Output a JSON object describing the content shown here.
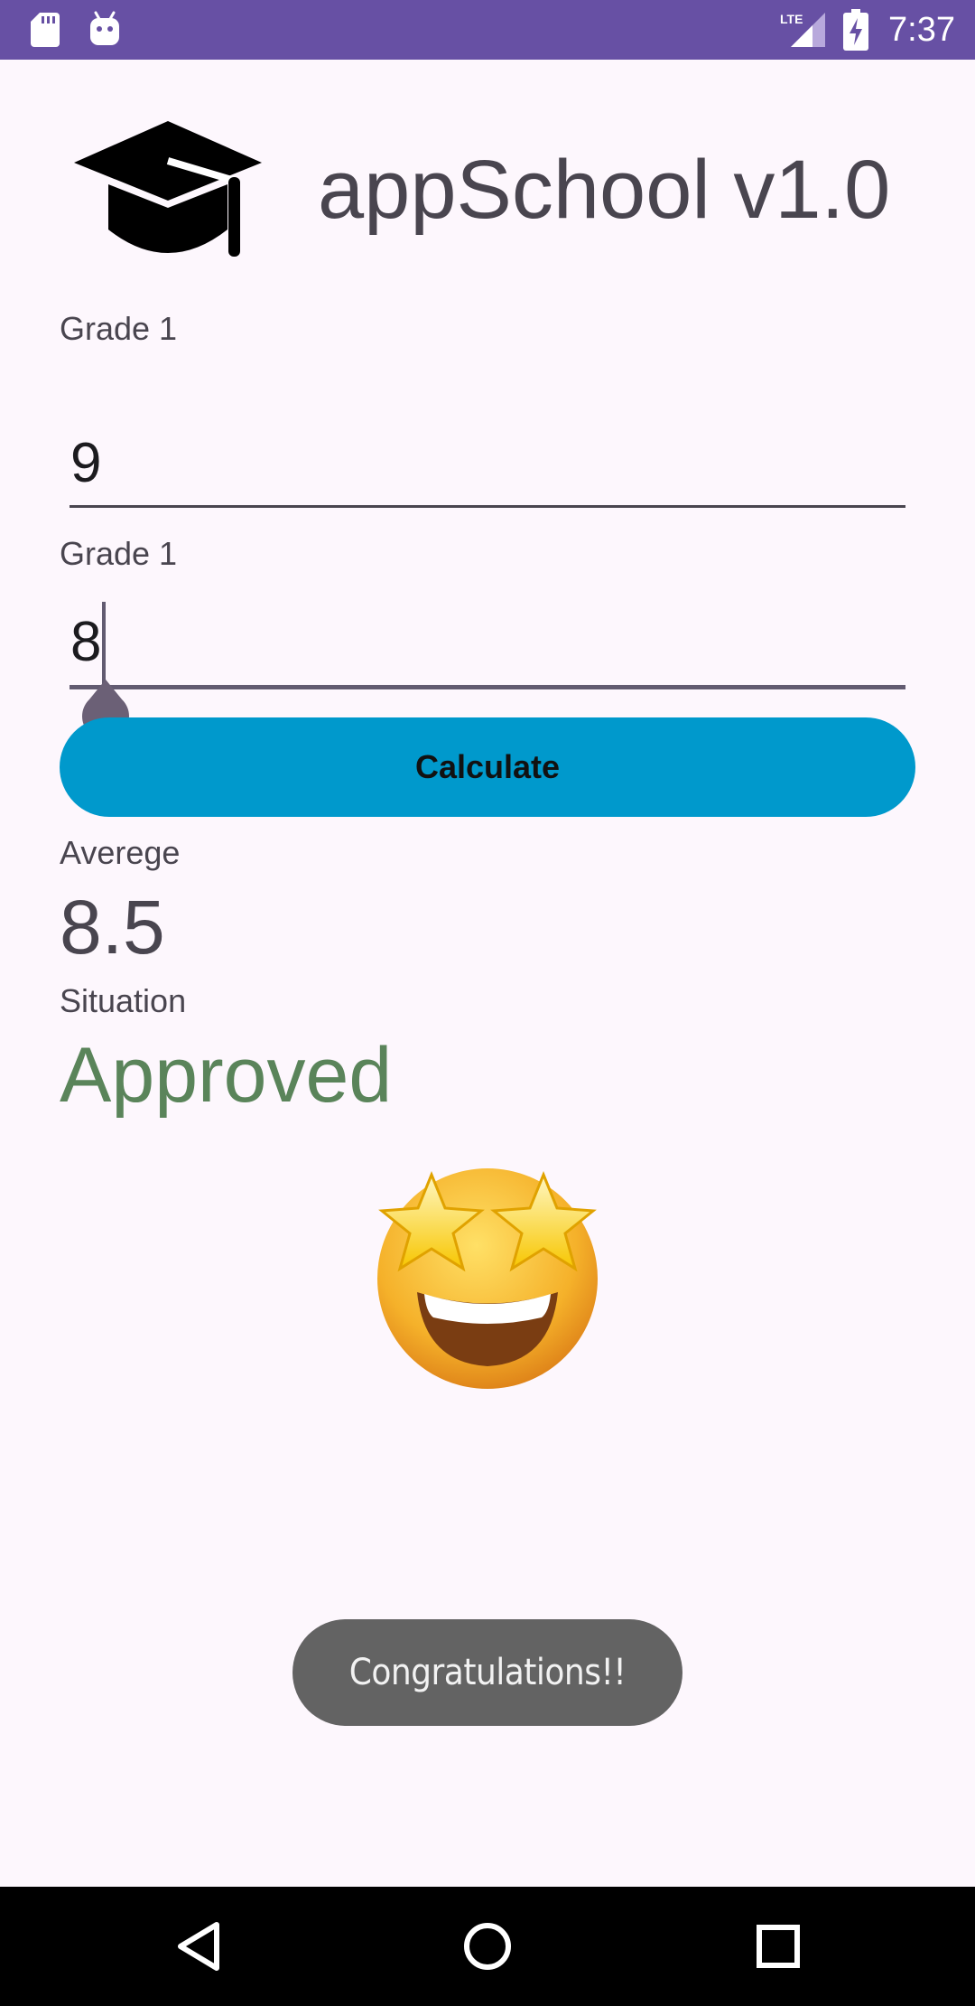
{
  "status_bar": {
    "time": "7:37",
    "network": "LTE",
    "icons": [
      "sd-card-icon",
      "android-debug-icon",
      "lte-signal-icon",
      "battery-charging-icon"
    ],
    "color": "#6750a4"
  },
  "header": {
    "logo_icon": "graduation-cap-icon",
    "title": "appSchool v1.0"
  },
  "form": {
    "grade1_label": "Grade 1",
    "grade1_value": "9",
    "grade2_label": "Grade 1",
    "grade2_value": "8",
    "calculate_label": "Calculate",
    "button_color": "#0099cc"
  },
  "result": {
    "average_label": "Averege",
    "average_value": "8.5",
    "situation_label": "Situation",
    "situation_value": "Approved",
    "situation_color": "#5a845a",
    "emoji_icon": "star-struck-emoji-icon"
  },
  "toast": {
    "message": "Congratulations!!"
  },
  "nav_bar": {
    "icons": [
      "back-icon",
      "home-icon",
      "recents-icon"
    ]
  }
}
